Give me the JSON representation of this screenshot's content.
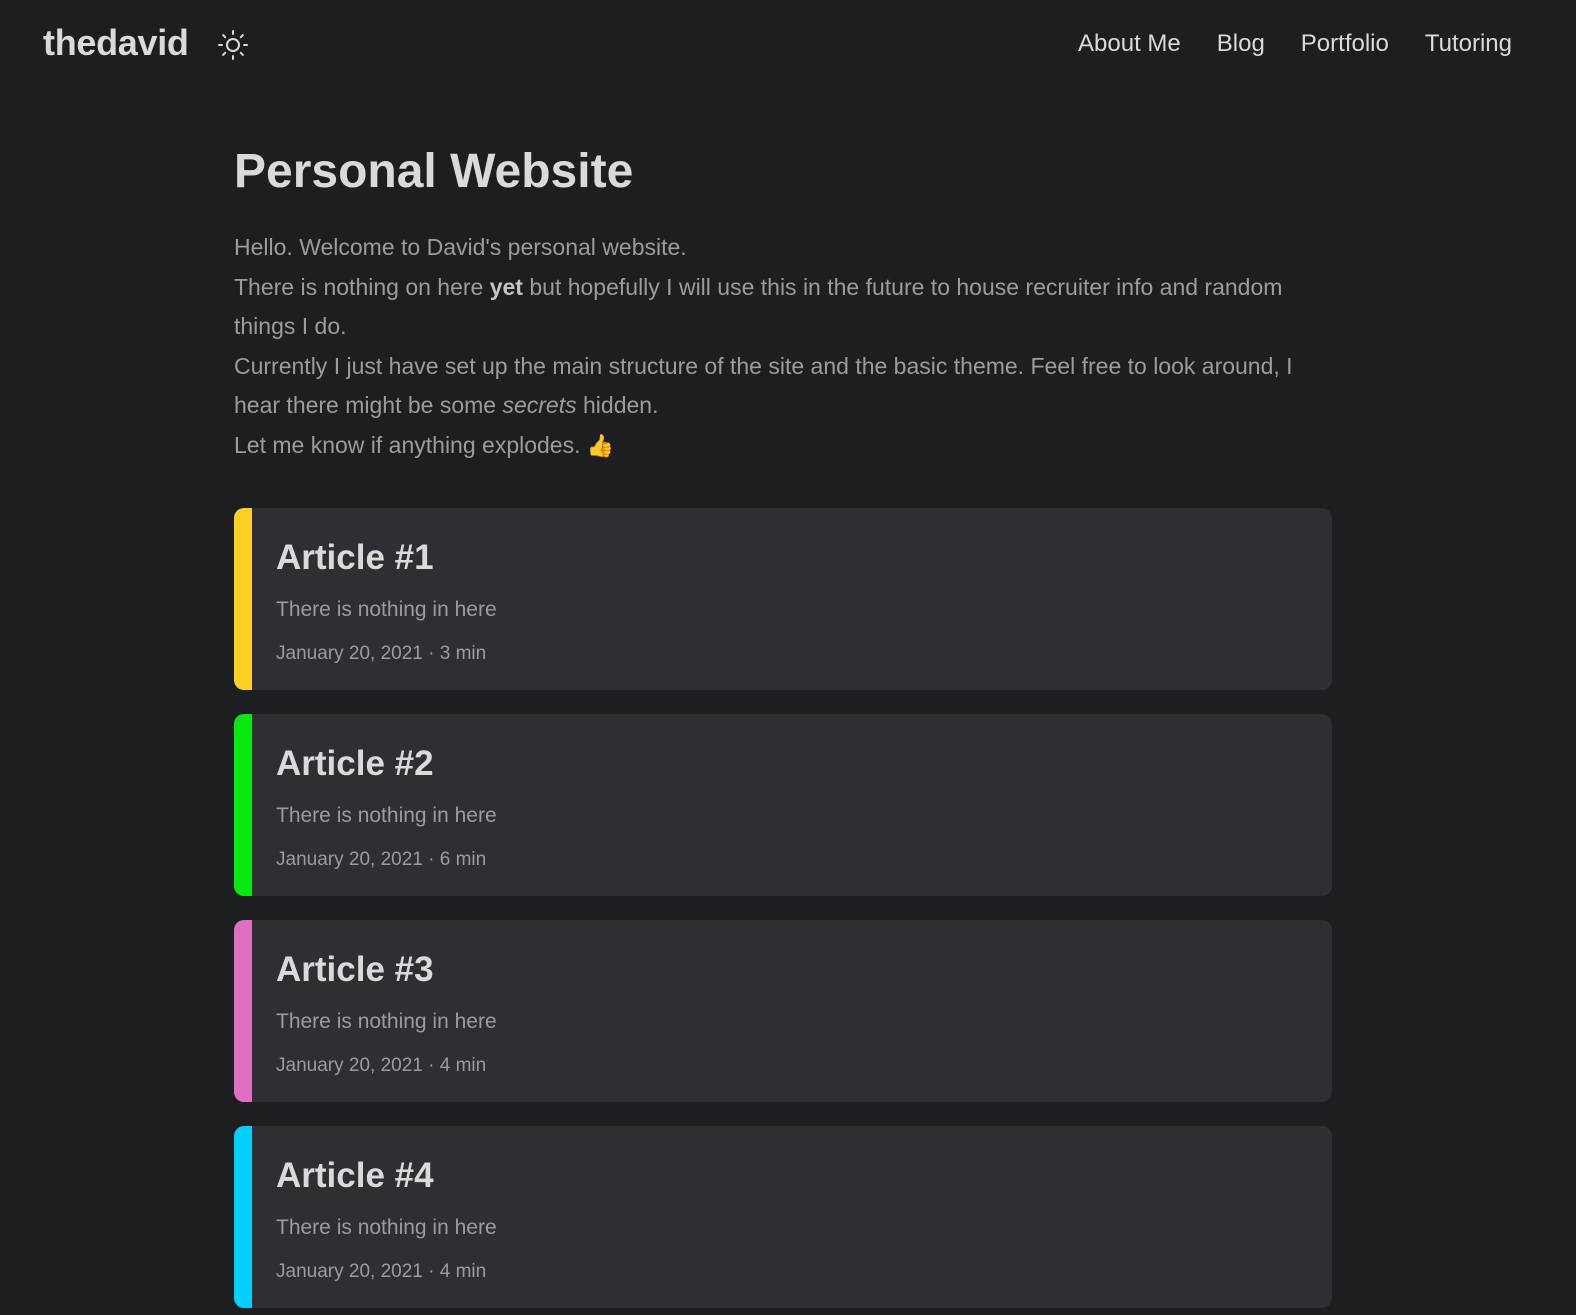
{
  "header": {
    "logo": "thedavid",
    "theme_icon": "sun-icon",
    "nav": [
      "About Me",
      "Blog",
      "Portfolio",
      "Tutoring"
    ]
  },
  "main": {
    "title": "Personal Website",
    "intro": {
      "line1": "Hello. Welcome to David's personal website.",
      "line2_pre": "There is nothing on here ",
      "line2_bold": "yet",
      "line2_post": " but hopefully I will use this in the future to house recruiter info and random things I do.",
      "line3_pre": "Currently I just have set up the main structure of the site and the basic theme. Feel free to look around, I hear there might be some ",
      "line3_em": "secrets",
      "line3_post": " hidden.",
      "line4": "Let me know if anything explodes.",
      "line4_emoji": "👍"
    }
  },
  "articles": [
    {
      "title": "Article #1",
      "summary": "There is nothing in here",
      "meta": "January 20, 2021 · 3 min",
      "color": "#fdd023"
    },
    {
      "title": "Article #2",
      "summary": "There is nothing in here",
      "meta": "January 20, 2021 · 6 min",
      "color": "#06e80f"
    },
    {
      "title": "Article #3",
      "summary": "There is nothing in here",
      "meta": "January 20, 2021 · 4 min",
      "color": "#de6fc3"
    },
    {
      "title": "Article #4",
      "summary": "There is nothing in here",
      "meta": "January 20, 2021 · 4 min",
      "color": "#00cfff"
    }
  ]
}
